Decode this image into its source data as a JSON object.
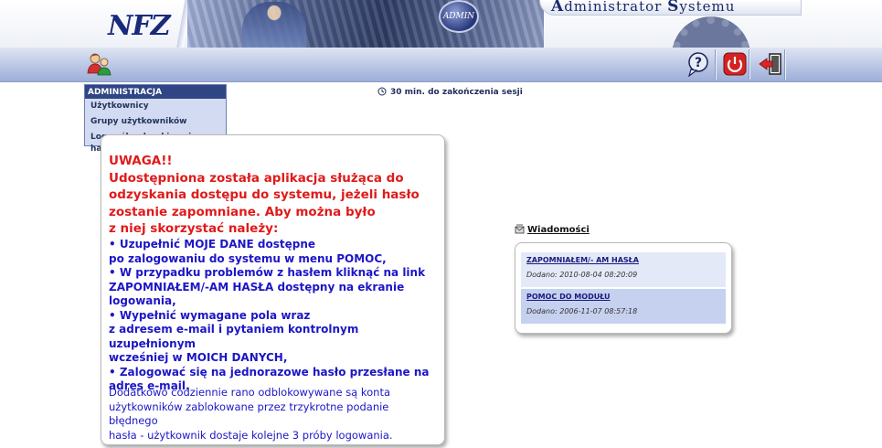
{
  "header": {
    "logo_text": "NFZ",
    "badge_text": "ADMIN",
    "app_title_first": "A",
    "app_title_mid": "dministrator ",
    "app_title_second": "S",
    "app_title_end": "ystemu"
  },
  "toolbar": {
    "left_icon": "users-admin-icon",
    "right_icons": [
      "help-icon",
      "power-icon",
      "logout-icon"
    ]
  },
  "menu": {
    "heading": "ADMINISTRACJA",
    "items": [
      "Użytkownicy",
      "Grupy użytkowników",
      "Log prób odzyskiwania hasła"
    ]
  },
  "session": {
    "text": "30 min. do zakończenia sesji"
  },
  "notice": {
    "heading_lines": [
      "UWAGA!!",
      "Udostępniona została aplikacja służąca do",
      "odzyskania dostępu do systemu, jeżeli hasło",
      "zostanie zapomniane. Aby można było",
      "z niej skorzystać należy:"
    ],
    "list_lines": [
      "• Uzupełnić MOJE DANE dostępne",
      "po zalogowaniu do systemu w menu POMOC,",
      "• W przypadku problemów z hasłem kliknąć na link",
      "ZAPOMNIAŁEM/-AM HASŁA dostępny na ekranie",
      "logowania,",
      "• Wypełnić wymagane pola wraz",
      "z adresem e-mail i pytaniem kontrolnym uzupełnionym",
      "wcześniej w MOICH DANYCH,",
      "• Zalogować się na jednorazowe hasło przesłane na",
      "adres e-mail."
    ],
    "footer_lines": [
      "Dodatkowo codziennie rano odblokowywane są konta",
      "użytkowników zablokowane przez trzykrotne podanie błędnego",
      "hasła - użytkownik dostaje kolejne 3 próby logowania."
    ]
  },
  "messages": {
    "title": "Wiadomości",
    "items": [
      {
        "link": "ZAPOMNIAŁEM/- AM HASŁA",
        "date": "Dodano: 2010-08-04  08:20:09",
        "bg": "#e3e9f6"
      },
      {
        "link": "POMOC DO MODUŁU",
        "date": "Dodano: 2006-11-07  08:57:18",
        "bg": "#c5d1ee"
      }
    ]
  },
  "colors": {
    "warning_red": "#e01a1a",
    "text_blue": "#1c16c6",
    "menu_header": "#2f4584",
    "menu_bg": "#d2dbf2"
  }
}
